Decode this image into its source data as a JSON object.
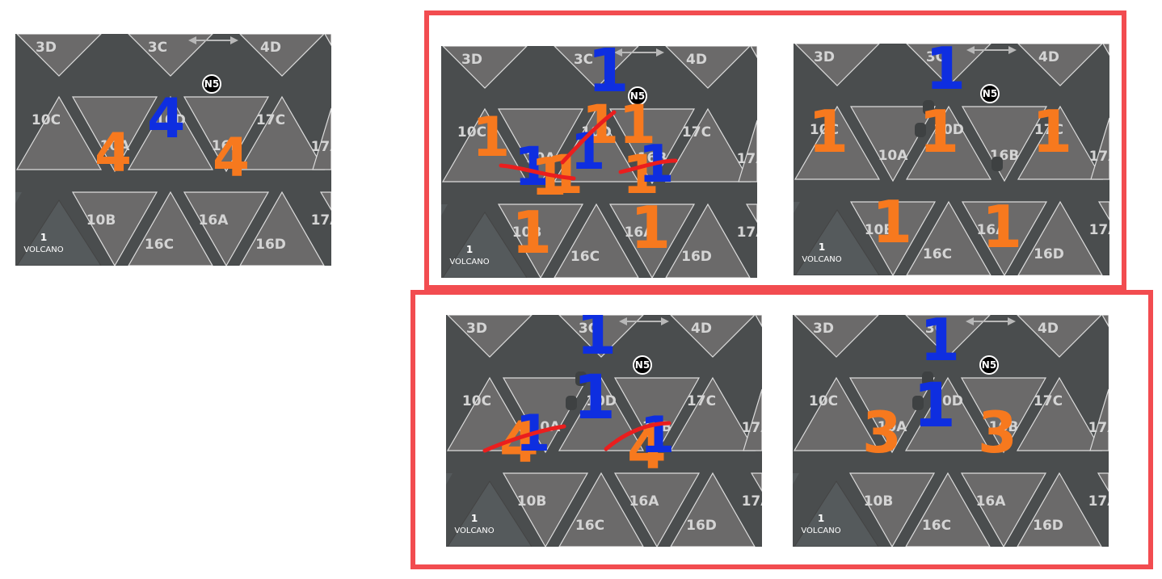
{
  "map": {
    "tiles_up": [
      "10C",
      "10A",
      "17C",
      "16A",
      "10B"
    ],
    "tiles_down": [
      "3D",
      "3C",
      "4D",
      "10D",
      "16B",
      "16C",
      "16D",
      "17A"
    ],
    "edge_tiles": [
      "17A",
      "17A"
    ],
    "badge": "N5",
    "volcano_number": "1",
    "volcano_label": "VOLCANO"
  },
  "panels": [
    {
      "id": "reference",
      "marks": [
        {
          "text": "4",
          "color": "blue"
        },
        {
          "text": "4",
          "color": "orange"
        },
        {
          "text": "4",
          "color": "orange"
        }
      ]
    },
    {
      "id": "top-left",
      "marks": [
        {
          "text": "1",
          "color": "blue"
        },
        {
          "text": "1",
          "color": "orange"
        },
        {
          "text": "11",
          "color": "orange"
        },
        {
          "text": "1",
          "color": "orange"
        },
        {
          "text": "1",
          "color": "blue"
        },
        {
          "text": "1",
          "color": "orange"
        },
        {
          "text": "1",
          "color": "blue"
        },
        {
          "text": "1",
          "color": "orange"
        },
        {
          "text": "1",
          "color": "blue"
        },
        {
          "text": "1",
          "color": "orange"
        },
        {
          "text": "1",
          "color": "orange"
        }
      ]
    },
    {
      "id": "top-right",
      "marks": [
        {
          "text": "1",
          "color": "blue"
        },
        {
          "text": "1",
          "color": "orange"
        },
        {
          "text": "1",
          "color": "orange"
        },
        {
          "text": "1",
          "color": "orange"
        },
        {
          "text": "1",
          "color": "orange"
        },
        {
          "text": "1",
          "color": "orange"
        }
      ]
    },
    {
      "id": "bottom-left",
      "marks": [
        {
          "text": "1",
          "color": "blue"
        },
        {
          "text": "1",
          "color": "blue"
        },
        {
          "text": "4",
          "color": "orange"
        },
        {
          "text": "1",
          "color": "blue"
        },
        {
          "text": "4",
          "color": "orange"
        },
        {
          "text": "1",
          "color": "blue"
        }
      ]
    },
    {
      "id": "bottom-right",
      "marks": [
        {
          "text": "1",
          "color": "blue"
        },
        {
          "text": "1",
          "color": "blue"
        },
        {
          "text": "3",
          "color": "orange"
        },
        {
          "text": "3",
          "color": "orange"
        }
      ]
    }
  ],
  "colors": {
    "orange": "#f7791e",
    "blue": "#0e2ee0",
    "strike": "#ea1e1e",
    "frame": "#f24c50",
    "board": "#4a4d4e",
    "tile": "#6b6a6a"
  }
}
